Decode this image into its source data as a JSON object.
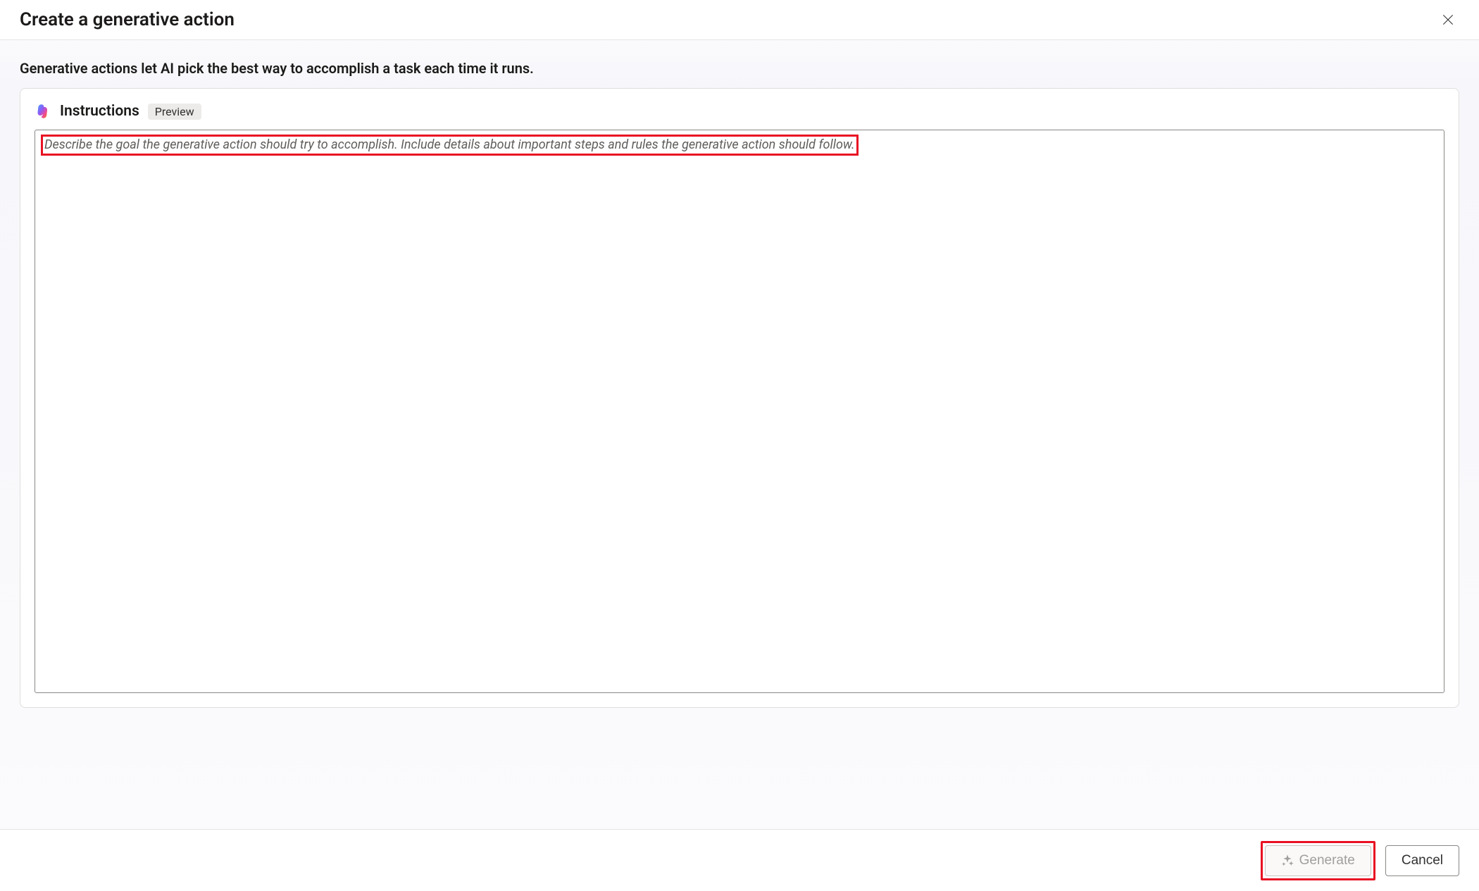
{
  "header": {
    "title": "Create a generative action"
  },
  "subheader": {
    "text": "Generative actions let AI pick the best way to accomplish a task each time it runs."
  },
  "card": {
    "title": "Instructions",
    "badge": "Preview",
    "placeholder": "Describe the goal the generative action should try to accomplish. Include details about important steps and rules the generative action should follow."
  },
  "footer": {
    "generate_label": "Generate",
    "cancel_label": "Cancel"
  }
}
